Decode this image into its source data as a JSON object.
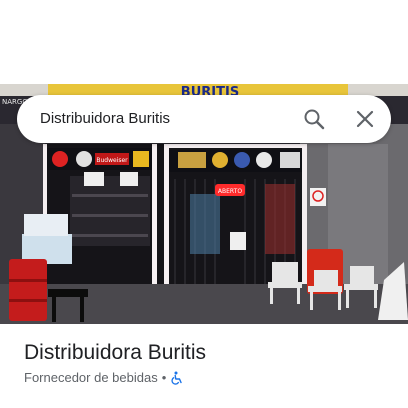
{
  "search": {
    "query": "Distribuidora Buritis",
    "search_icon": "search-icon",
    "close_icon": "close-icon"
  },
  "photo": {
    "shop_sign": "BURITIS",
    "left_sign_fragment": "NARGO",
    "beer_sign": "Budweiser",
    "neon_sign": "ABERTO",
    "notice": "Proibido fumar"
  },
  "place": {
    "name": "Distribuidora Buritis",
    "category": "Fornecedor de bebidas",
    "separator": "•",
    "accessibility_icon": "wheelchair-accessible-icon"
  },
  "colors": {
    "accessibility_icon": "#1a73e8",
    "title_text": "#202124",
    "secondary_text": "#5f6368"
  }
}
